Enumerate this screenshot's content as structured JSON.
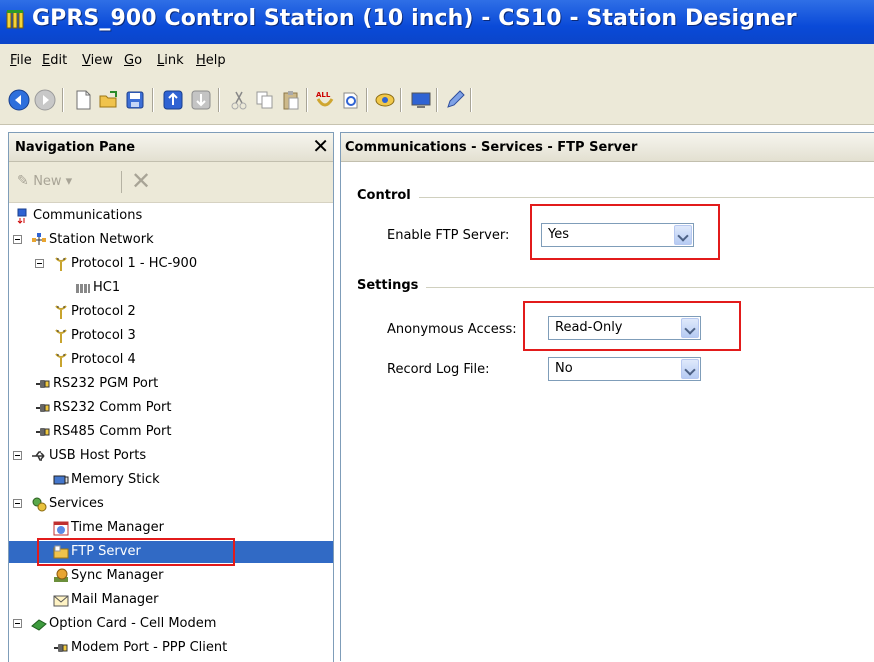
{
  "window": {
    "title": "GPRS_900 Control Station (10 inch) - CS10 - Station Designer"
  },
  "menu": [
    {
      "label": "File",
      "key": "F",
      "rest": "ile"
    },
    {
      "label": "Edit",
      "key": "E",
      "rest": "dit"
    },
    {
      "label": "View",
      "key": "V",
      "rest": "iew"
    },
    {
      "label": "Go",
      "key": "G",
      "rest": "o"
    },
    {
      "label": "Link",
      "key": "L",
      "rest": "ink"
    },
    {
      "label": "Help",
      "key": "H",
      "rest": "elp"
    }
  ],
  "toolbar": {
    "buttons": [
      "back-icon",
      "forward-icon",
      "new-icon",
      "open-icon",
      "save-icon",
      "upload-icon",
      "download-icon",
      "cut-icon",
      "copy-icon",
      "paste-icon",
      "find-all-icon",
      "find-icon",
      "link-icon",
      "monitor-icon",
      "edit-icon"
    ]
  },
  "nav": {
    "title": "Navigation Pane",
    "close_glyph": "✕",
    "new_label": "New ▾",
    "delete_glyph": "✕",
    "tree": [
      {
        "label": "Communications",
        "icon": "communications-icon"
      },
      {
        "label": "Station Network",
        "icon": "network-icon"
      },
      {
        "label": "Protocol 1 - HC-900",
        "icon": "protocol-icon"
      },
      {
        "label": "HC1",
        "icon": "controller-icon"
      },
      {
        "label": "Protocol 2",
        "icon": "protocol-icon"
      },
      {
        "label": "Protocol 3",
        "icon": "protocol-icon"
      },
      {
        "label": "Protocol 4",
        "icon": "protocol-icon"
      },
      {
        "label": "RS232 PGM Port",
        "icon": "serial-port-icon"
      },
      {
        "label": "RS232 Comm Port",
        "icon": "serial-port-icon"
      },
      {
        "label": "RS485 Comm Port",
        "icon": "serial-port-icon"
      },
      {
        "label": "USB Host Ports",
        "icon": "usb-icon"
      },
      {
        "label": "Memory Stick",
        "icon": "memory-stick-icon"
      },
      {
        "label": "Services",
        "icon": "services-icon"
      },
      {
        "label": "Time Manager",
        "icon": "clock-icon"
      },
      {
        "label": "FTP Server",
        "icon": "ftp-folder-icon"
      },
      {
        "label": "Sync Manager",
        "icon": "sync-icon"
      },
      {
        "label": "Mail Manager",
        "icon": "mail-icon"
      },
      {
        "label": "Option Card - Cell Modem",
        "icon": "option-card-icon"
      },
      {
        "label": "Modem Port - PPP Client",
        "icon": "serial-port-icon"
      }
    ]
  },
  "content": {
    "header": "Communications - Services - FTP Server",
    "control": {
      "title": "Control",
      "enable_label": "Enable FTP Server:",
      "enable_value": "Yes"
    },
    "settings": {
      "title": "Settings",
      "anon_label": "Anonymous Access:",
      "anon_value": "Read-Only",
      "log_label": "Record Log File:",
      "log_value": "No"
    }
  },
  "colors": {
    "highlight_box": "#e21b1b",
    "selection": "#316ac5",
    "titlebar": "#0a4ad8"
  }
}
